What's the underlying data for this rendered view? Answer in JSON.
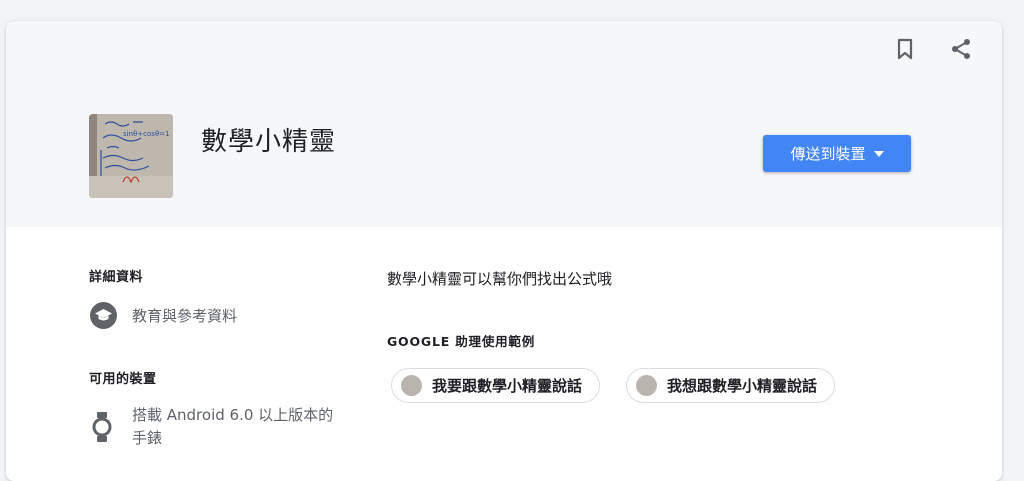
{
  "header": {
    "app_title": "數學小精靈",
    "send_button_label": "傳送到裝置",
    "bookmark_icon": "bookmark-icon",
    "share_icon": "share-icon",
    "thumbnail_text": "sinθ+cosθ=1"
  },
  "details": {
    "section_title": "詳細資料",
    "category_label": "教育與參考資料",
    "category_icon": "graduation-cap-icon"
  },
  "devices": {
    "section_title": "可用的裝置",
    "device_label": "搭載 Android 6.0 以上版本的手錶",
    "device_icon": "watch-icon"
  },
  "main": {
    "description": "數學小精靈可以幫你們找出公式哦",
    "examples_title": "GOOGLE 助理使用範例",
    "examples": [
      "我要跟數學小精靈說話",
      "我想跟數學小精靈說話"
    ]
  },
  "colors": {
    "accent": "#4285f4",
    "header_bg": "#f6f7f9",
    "page_bg": "#f1f3f4",
    "icon_gray": "#5f6368"
  }
}
